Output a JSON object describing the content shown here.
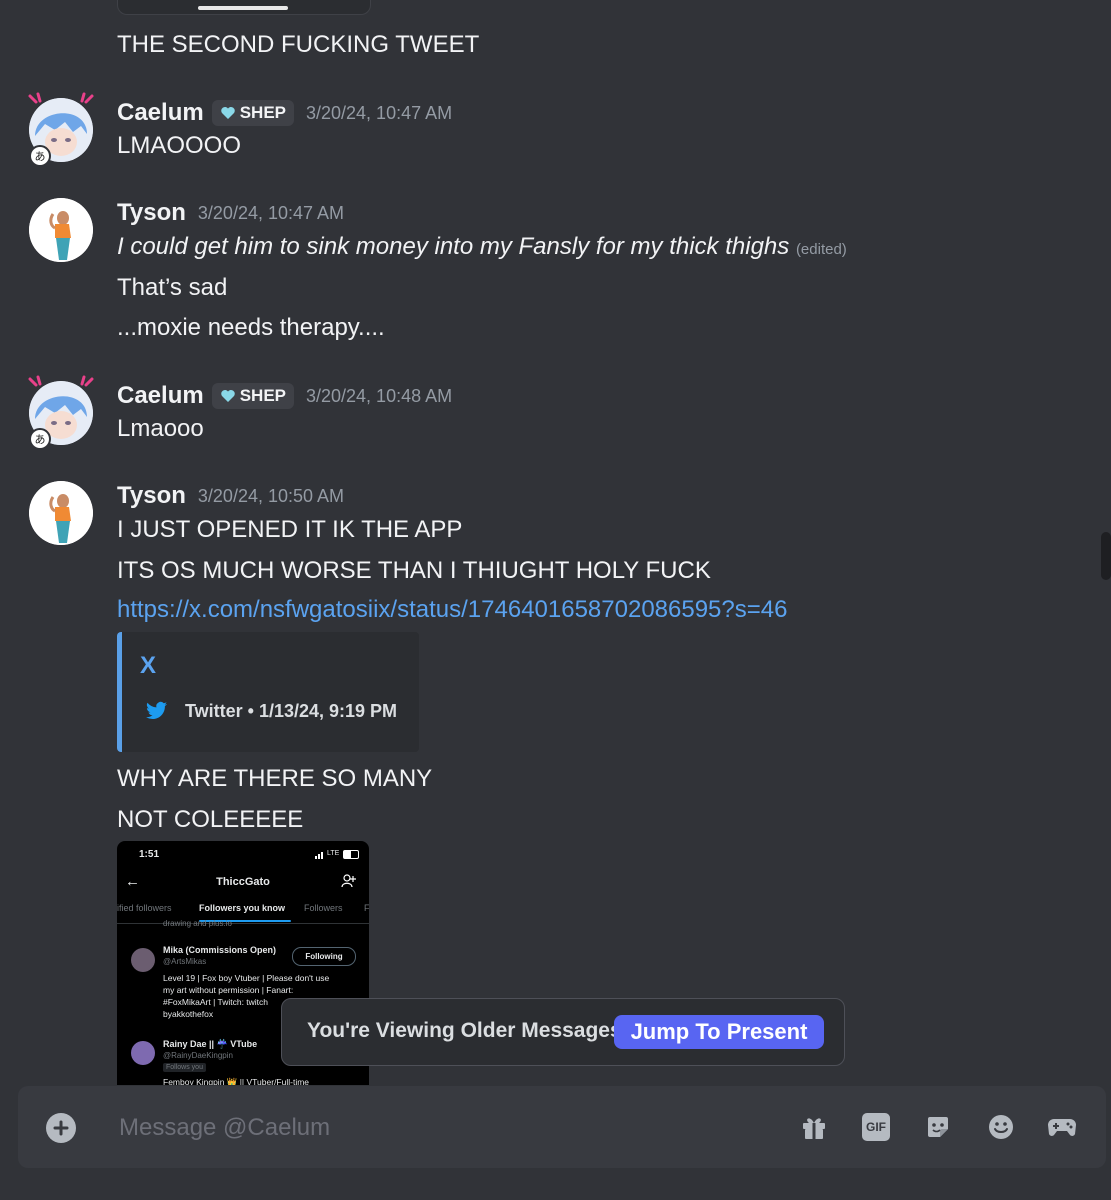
{
  "messages": {
    "m0_text": "THE SECOND FUCKING TWEET",
    "m1": {
      "user": "Caelum",
      "tag": "SHEP",
      "time": "3/20/24, 10:47 AM",
      "text": "LMAOOOO"
    },
    "m2": {
      "user": "Tyson",
      "time": "3/20/24, 10:47 AM",
      "line1": "I could get him to sink money into my Fansly for my thick thighs",
      "edited": "(edited)",
      "line2": "That’s sad",
      "line3": "...moxie needs therapy...."
    },
    "m3": {
      "user": "Caelum",
      "tag": "SHEP",
      "time": "3/20/24, 10:48 AM",
      "text": "Lmaooo"
    },
    "m4": {
      "user": "Tyson",
      "time": "3/20/24, 10:50 AM",
      "line1": "I JUST OPENED IT IK THE APP",
      "line2": "ITS OS MUCH WORSE THAN I THIUGHT HOLY FUCK",
      "link": "https://x.com/nsfwgatosiix/status/1746401658702086595?s=46",
      "embed_title": "X",
      "embed_footer": "Twitter • 1/13/24, 9:19 PM",
      "line3": "WHY ARE THERE SO MANY",
      "line4": "NOT COLEEEEE"
    }
  },
  "phone_screenshot": {
    "time": "1:51",
    "status": "LTE",
    "title": "ThiccGato",
    "tab_left": "ified followers",
    "tab_active": "Followers you know",
    "tab_right": "Followers",
    "tab_cut": "F",
    "partial_text": "drawing and plus.io",
    "user1_name": "Mika (Commissions Open)",
    "user1_handle": "@ArtsMikas",
    "user1_button": "Following",
    "user1_bio1": "Level 19 | Fox boy Vtuber | Please don't use",
    "user1_bio2": "my art without permission | Fanart:",
    "user1_bio3": "#FoxMikaArt | Twitch: twitch",
    "user1_bio4": "byakkothefox",
    "user2_name": "Rainy Dae || ☔ VTube",
    "user2_handle": "@RainyDaeKingpin",
    "user2_badge": "Follows you",
    "user2_bio": "Femboy Kingpin 👑 || VTuber/Full-time"
  },
  "toast": {
    "text": "You're Viewing Older Messages",
    "button": "Jump To Present"
  },
  "composer": {
    "placeholder": "Message @Caelum"
  },
  "colors": {
    "background": "#313338",
    "accent": "#5865f2",
    "link": "#5ba3f0",
    "twitter": "#1d9bf0"
  }
}
